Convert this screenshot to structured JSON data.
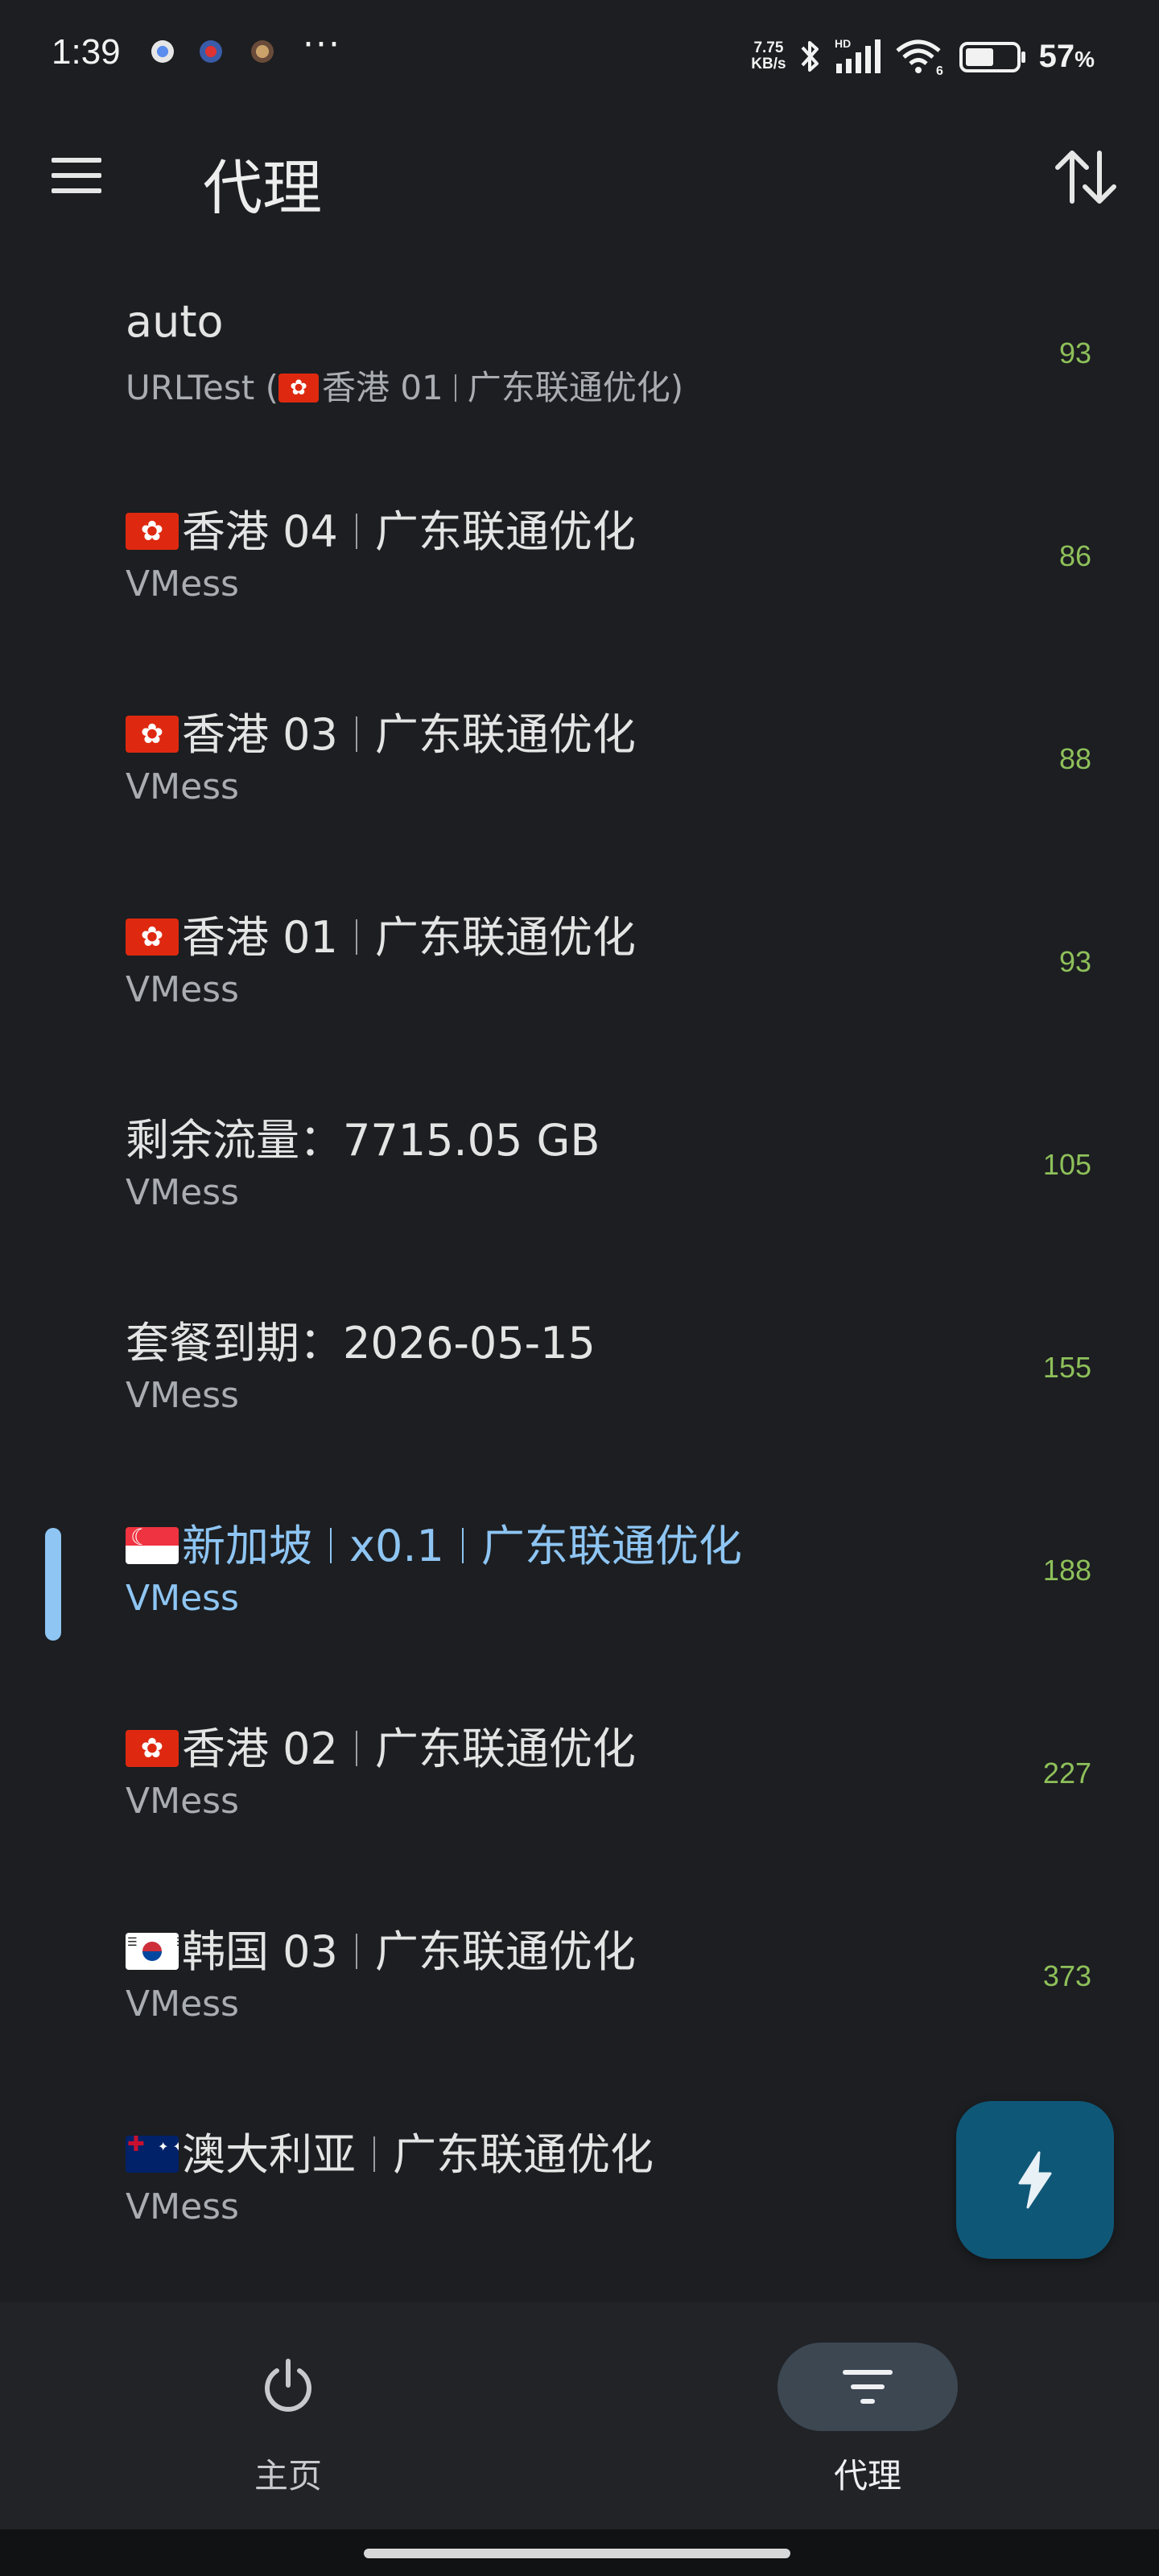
{
  "status_bar": {
    "time": "1:39",
    "net_speed_value": "7.75",
    "net_speed_unit": "KB/s",
    "hd_label": "HD",
    "wifi_badge": "6",
    "battery_percent": "57",
    "battery_percent_sign": "%",
    "battery_level": 0.57,
    "more_dots": "···"
  },
  "header": {
    "title": "代理"
  },
  "proxies": [
    {
      "flag": "",
      "name": "auto",
      "type_prefix": "URLTest (",
      "type_flag": "hk",
      "type_name": "香港 01",
      "type_suffix": "广东联通优化)",
      "latency": "93"
    },
    {
      "flag": "hk",
      "name_a": "香港 04",
      "name_b": "广东联通优化",
      "type": "VMess",
      "latency": "86"
    },
    {
      "flag": "hk",
      "name_a": "香港 03",
      "name_b": "广东联通优化",
      "type": "VMess",
      "latency": "88"
    },
    {
      "flag": "hk",
      "name_a": "香港 01",
      "name_b": "广东联通优化",
      "type": "VMess",
      "latency": "93"
    },
    {
      "flag": "",
      "name": "剩余流量：7715.05 GB",
      "type": "VMess",
      "latency": "105"
    },
    {
      "flag": "",
      "name": "套餐到期：2026-05-15",
      "type": "VMess",
      "latency": "155"
    },
    {
      "flag": "sg",
      "name_a": "新加坡",
      "name_mid": "x0.1",
      "name_b": "广东联通优化",
      "type": "VMess",
      "latency": "188",
      "selected": true
    },
    {
      "flag": "hk",
      "name_a": "香港 02",
      "name_b": "广东联通优化",
      "type": "VMess",
      "latency": "227"
    },
    {
      "flag": "kr",
      "name_a": "韩国 03",
      "name_b": "广东联通优化",
      "type": "VMess",
      "latency": "373"
    },
    {
      "flag": "au",
      "name_a": "澳大利亚",
      "name_b": "广东联通优化",
      "type": "VMess",
      "latency": ""
    }
  ],
  "nav": {
    "home_label": "主页",
    "proxy_label": "代理"
  },
  "colors": {
    "background": "#1c1e21",
    "latency": "#8ec05a",
    "selected": "#8ec5f3",
    "fab": "#0f5777"
  },
  "icons": {
    "menu": "menu-icon",
    "sort": "sort-icon",
    "fab": "flash-icon",
    "home": "power-icon",
    "proxy": "filter-list-icon"
  }
}
